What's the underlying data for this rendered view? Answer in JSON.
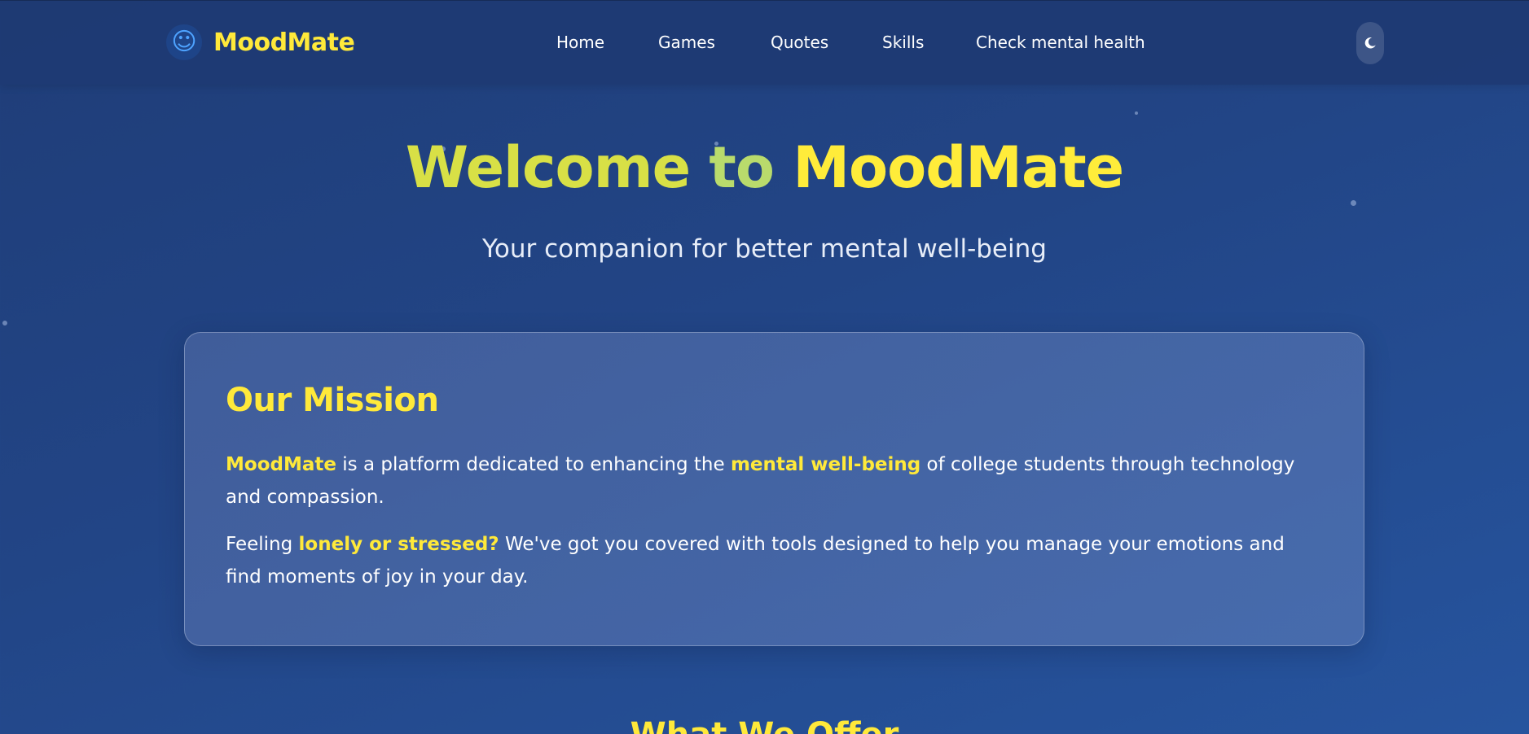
{
  "navbar": {
    "brand_name": "MoodMate",
    "brand_icon": "smiley-face-icon",
    "links": [
      {
        "label": "Home"
      },
      {
        "label": "Games"
      },
      {
        "label": "Quotes"
      },
      {
        "label": "Skills"
      },
      {
        "label": "Check mental health"
      }
    ],
    "theme_toggle_icon": "moon-icon"
  },
  "hero": {
    "title_part1": "Welcome",
    "title_part2": "to",
    "title_part3": "MoodMate",
    "subtitle": "Your companion for better mental well-being"
  },
  "mission": {
    "title": "Our Mission",
    "p1_highlight1": "MoodMate",
    "p1_text1": " is a platform dedicated to enhancing the ",
    "p1_highlight2": "mental well-being",
    "p1_text2": " of college students through technology and compassion.",
    "p2_text1": "Feeling ",
    "p2_highlight": "lonely or stressed?",
    "p2_text2": " We've got you covered with tools designed to help you manage your emotions and find moments of joy in your day."
  },
  "offer": {
    "title": "What We Offer"
  },
  "colors": {
    "accent_yellow": "#ffe93a",
    "gradient_green": "#b9db6c",
    "background_blue": "#224586"
  }
}
